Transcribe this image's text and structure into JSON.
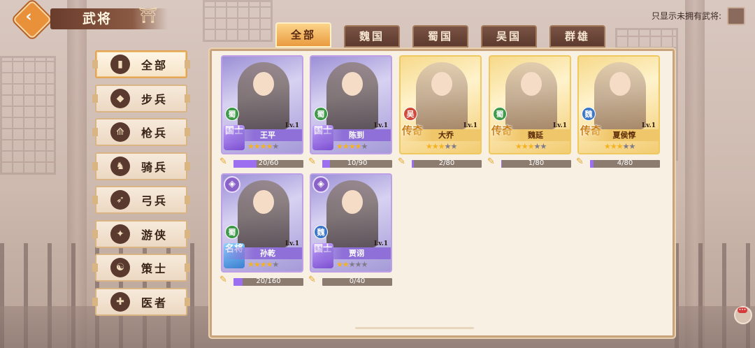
{
  "header": {
    "title": "武将",
    "back_icon": "back-arrow-icon",
    "filter_label": "只显示未拥有武将:"
  },
  "tabs": [
    "全部",
    "魏国",
    "蜀国",
    "吴国",
    "群雄"
  ],
  "active_tab": 0,
  "sidebar": {
    "items": [
      {
        "label": "全部",
        "icon": "book-icon"
      },
      {
        "label": "步兵",
        "icon": "shield-icon"
      },
      {
        "label": "枪兵",
        "icon": "spear-icon"
      },
      {
        "label": "骑兵",
        "icon": "horse-icon"
      },
      {
        "label": "弓兵",
        "icon": "bow-icon"
      },
      {
        "label": "游侠",
        "icon": "ranger-icon"
      },
      {
        "label": "策士",
        "icon": "strategist-icon"
      },
      {
        "label": "医者",
        "icon": "healer-icon"
      }
    ],
    "active": 0
  },
  "generals": [
    {
      "name": "王平",
      "faction": "蜀",
      "rank": "国士",
      "level": "Lv.1",
      "stars": 4,
      "fragments": "20/60",
      "progress": 0.333,
      "card": "purple"
    },
    {
      "name": "陈到",
      "faction": "蜀",
      "rank": "国士",
      "level": "Lv.1",
      "stars": 4,
      "fragments": "10/90",
      "progress": 0.111,
      "card": "purple"
    },
    {
      "name": "大乔",
      "faction": "吴",
      "rank": "传奇",
      "level": "Lv.1",
      "stars": 3,
      "fragments": "2/80",
      "progress": 0.025,
      "card": "gold"
    },
    {
      "name": "魏延",
      "faction": "蜀",
      "rank": "传奇",
      "level": "Lv.1",
      "stars": 3,
      "fragments": "1/80",
      "progress": 0.0125,
      "card": "gold"
    },
    {
      "name": "夏侯惇",
      "faction": "魏",
      "rank": "传奇",
      "level": "Lv.1",
      "stars": 3,
      "fragments": "4/80",
      "progress": 0.05,
      "card": "gold"
    },
    {
      "name": "孙乾",
      "faction": "蜀",
      "rank": "名将",
      "level": "Lv.1",
      "stars": 4,
      "fragments": "20/160",
      "progress": 0.125,
      "card": "purple"
    },
    {
      "name": "贾诩",
      "faction": "魏",
      "rank": "国士",
      "level": "Lv.1",
      "stars": 2,
      "fragments": "0/40",
      "progress": 0,
      "card": "purple"
    }
  ],
  "colors": {
    "accent_gold": "#e99b3e",
    "rank_purple": "#8f70d8",
    "fragment_bar": "#9b6ff0"
  }
}
